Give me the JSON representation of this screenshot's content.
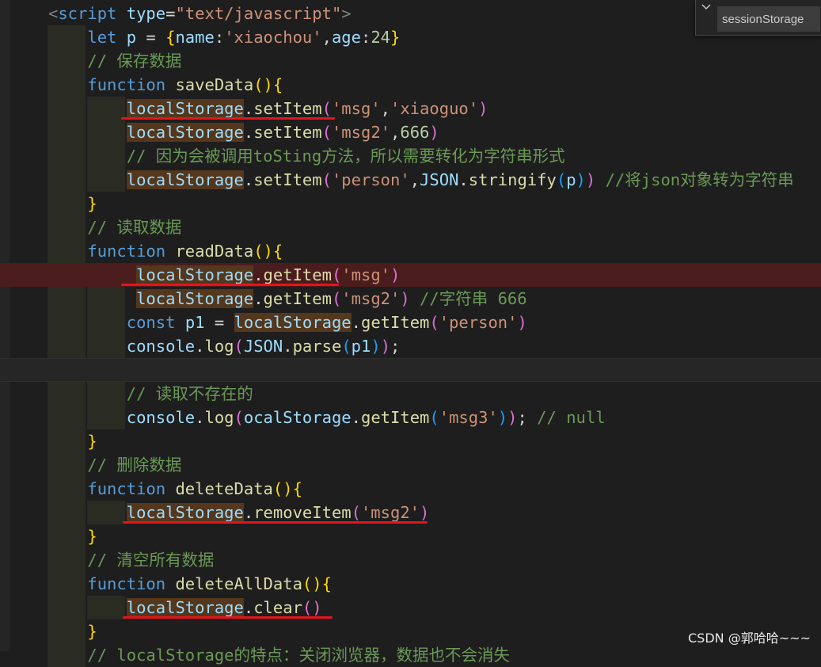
{
  "find_widget": {
    "value": "sessionStorage",
    "toggle_icon": "chevron-down-icon"
  },
  "watermark": "CSDN @郭哈哈~~~",
  "lines": [
    {
      "guides": [],
      "tokens": [
        {
          "t": "<",
          "c": "c-punc"
        },
        {
          "t": "script",
          "c": "c-tag"
        },
        {
          "t": " ",
          "c": "c-text"
        },
        {
          "t": "type",
          "c": "c-attr"
        },
        {
          "t": "=",
          "c": "c-text"
        },
        {
          "t": "\"text/javascript\"",
          "c": "c-str"
        },
        {
          "t": ">",
          "c": "c-punc"
        }
      ]
    },
    {
      "guides": [
        60
      ],
      "tokens": [
        {
          "t": "    ",
          "c": "c-text"
        },
        {
          "t": "let",
          "c": "c-kw"
        },
        {
          "t": " ",
          "c": "c-text"
        },
        {
          "t": "p",
          "c": "c-var"
        },
        {
          "t": " = ",
          "c": "c-text"
        },
        {
          "t": "{",
          "c": "c-b1"
        },
        {
          "t": "name",
          "c": "c-var"
        },
        {
          "t": ":",
          "c": "c-text"
        },
        {
          "t": "'xiaochou'",
          "c": "c-str"
        },
        {
          "t": ",",
          "c": "c-text"
        },
        {
          "t": "age",
          "c": "c-var"
        },
        {
          "t": ":",
          "c": "c-text"
        },
        {
          "t": "24",
          "c": "c-num"
        },
        {
          "t": "}",
          "c": "c-b1"
        }
      ]
    },
    {
      "guides": [
        60
      ],
      "tokens": [
        {
          "t": "    ",
          "c": "c-text"
        },
        {
          "t": "// 保存数据",
          "c": "c-com"
        }
      ]
    },
    {
      "guides": [
        60
      ],
      "tokens": [
        {
          "t": "    ",
          "c": "c-text"
        },
        {
          "t": "function",
          "c": "c-kw"
        },
        {
          "t": " ",
          "c": "c-text"
        },
        {
          "t": "saveData",
          "c": "c-fn"
        },
        {
          "t": "()",
          "c": "c-b1"
        },
        {
          "t": "{",
          "c": "c-b1"
        }
      ]
    },
    {
      "guides": [
        60,
        110
      ],
      "tokens": [
        {
          "t": "        ",
          "c": "c-text"
        },
        {
          "t": "localStorage",
          "c": "c-var",
          "hl": true
        },
        {
          "t": ".",
          "c": "c-text"
        },
        {
          "t": "setItem",
          "c": "c-fn"
        },
        {
          "t": "(",
          "c": "c-b2"
        },
        {
          "t": "'msg'",
          "c": "c-str"
        },
        {
          "t": ",",
          "c": "c-text"
        },
        {
          "t": "'xiaoguo'",
          "c": "c-str"
        },
        {
          "t": ")",
          "c": "c-b2"
        }
      ]
    },
    {
      "guides": [
        60,
        110
      ],
      "tokens": [
        {
          "t": "        ",
          "c": "c-text"
        },
        {
          "t": "localStorage",
          "c": "c-var",
          "hl": true
        },
        {
          "t": ".",
          "c": "c-text"
        },
        {
          "t": "setItem",
          "c": "c-fn"
        },
        {
          "t": "(",
          "c": "c-b2"
        },
        {
          "t": "'msg2'",
          "c": "c-str"
        },
        {
          "t": ",",
          "c": "c-text"
        },
        {
          "t": "666",
          "c": "c-num"
        },
        {
          "t": ")",
          "c": "c-b2"
        }
      ]
    },
    {
      "guides": [
        60,
        110
      ],
      "tokens": [
        {
          "t": "        ",
          "c": "c-text"
        },
        {
          "t": "// 因为会被调用toSting方法，所以需要转化为字符串形式",
          "c": "c-com"
        }
      ]
    },
    {
      "guides": [
        60,
        110
      ],
      "tokens": [
        {
          "t": "        ",
          "c": "c-text"
        },
        {
          "t": "localStorage",
          "c": "c-var",
          "hl": true
        },
        {
          "t": ".",
          "c": "c-text"
        },
        {
          "t": "setItem",
          "c": "c-fn"
        },
        {
          "t": "(",
          "c": "c-b2"
        },
        {
          "t": "'person'",
          "c": "c-str"
        },
        {
          "t": ",",
          "c": "c-text"
        },
        {
          "t": "JSON",
          "c": "c-var"
        },
        {
          "t": ".",
          "c": "c-text"
        },
        {
          "t": "stringify",
          "c": "c-fn"
        },
        {
          "t": "(",
          "c": "c-b3"
        },
        {
          "t": "p",
          "c": "c-var"
        },
        {
          "t": ")",
          "c": "c-b3"
        },
        {
          "t": ")",
          "c": "c-b2"
        },
        {
          "t": " ",
          "c": "c-text"
        },
        {
          "t": "//将json对象转为字符串",
          "c": "c-com"
        }
      ]
    },
    {
      "guides": [
        60
      ],
      "tokens": [
        {
          "t": "    ",
          "c": "c-text"
        },
        {
          "t": "}",
          "c": "c-b1"
        }
      ]
    },
    {
      "guides": [
        60
      ],
      "tokens": [
        {
          "t": "    ",
          "c": "c-text"
        },
        {
          "t": "// 读取数据",
          "c": "c-com"
        }
      ]
    },
    {
      "guides": [
        60
      ],
      "tokens": [
        {
          "t": "    ",
          "c": "c-text"
        },
        {
          "t": "function",
          "c": "c-kw"
        },
        {
          "t": " ",
          "c": "c-text"
        },
        {
          "t": "readData",
          "c": "c-fn"
        },
        {
          "t": "()",
          "c": "c-b1"
        },
        {
          "t": "{",
          "c": "c-b1"
        }
      ]
    },
    {
      "guides": [],
      "err": true,
      "tokens": [
        {
          "t": "         ",
          "c": "c-text"
        },
        {
          "t": "localStorage",
          "c": "c-var",
          "hl": true
        },
        {
          "t": ".",
          "c": "c-text"
        },
        {
          "t": "getItem",
          "c": "c-fn"
        },
        {
          "t": "(",
          "c": "c-b2"
        },
        {
          "t": "'msg'",
          "c": "c-str"
        },
        {
          "t": ")",
          "c": "c-b2"
        }
      ]
    },
    {
      "guides": [
        60,
        110
      ],
      "tokens": [
        {
          "t": "         ",
          "c": "c-text"
        },
        {
          "t": "localStorage",
          "c": "c-var",
          "hl": true
        },
        {
          "t": ".",
          "c": "c-text"
        },
        {
          "t": "getItem",
          "c": "c-fn"
        },
        {
          "t": "(",
          "c": "c-b2"
        },
        {
          "t": "'msg2'",
          "c": "c-str"
        },
        {
          "t": ")",
          "c": "c-b2"
        },
        {
          "t": " ",
          "c": "c-text"
        },
        {
          "t": "//字符串 666",
          "c": "c-com"
        }
      ]
    },
    {
      "guides": [
        60,
        110
      ],
      "tokens": [
        {
          "t": "        ",
          "c": "c-text"
        },
        {
          "t": "const",
          "c": "c-kw"
        },
        {
          "t": " ",
          "c": "c-text"
        },
        {
          "t": "p1",
          "c": "c-var"
        },
        {
          "t": " = ",
          "c": "c-text"
        },
        {
          "t": "localStorage",
          "c": "c-var",
          "hl": true
        },
        {
          "t": ".",
          "c": "c-text"
        },
        {
          "t": "getItem",
          "c": "c-fn"
        },
        {
          "t": "(",
          "c": "c-b2"
        },
        {
          "t": "'person'",
          "c": "c-str"
        },
        {
          "t": ")",
          "c": "c-b2"
        }
      ]
    },
    {
      "guides": [
        60,
        110
      ],
      "tokens": [
        {
          "t": "        ",
          "c": "c-text"
        },
        {
          "t": "console",
          "c": "c-var"
        },
        {
          "t": ".",
          "c": "c-text"
        },
        {
          "t": "log",
          "c": "c-fn"
        },
        {
          "t": "(",
          "c": "c-b2"
        },
        {
          "t": "JSON",
          "c": "c-var"
        },
        {
          "t": ".",
          "c": "c-text"
        },
        {
          "t": "parse",
          "c": "c-fn"
        },
        {
          "t": "(",
          "c": "c-b3"
        },
        {
          "t": "p1",
          "c": "c-var"
        },
        {
          "t": ")",
          "c": "c-b3"
        },
        {
          "t": ")",
          "c": "c-b2"
        },
        {
          "t": ";",
          "c": "c-text"
        }
      ]
    },
    {
      "guides": [],
      "cur": true,
      "tokens": []
    },
    {
      "guides": [
        60,
        110
      ],
      "tokens": [
        {
          "t": "        ",
          "c": "c-text"
        },
        {
          "t": "// 读取不存在的",
          "c": "c-com"
        }
      ]
    },
    {
      "guides": [
        60,
        110
      ],
      "tokens": [
        {
          "t": "        ",
          "c": "c-text"
        },
        {
          "t": "console",
          "c": "c-var"
        },
        {
          "t": ".",
          "c": "c-text"
        },
        {
          "t": "log",
          "c": "c-fn"
        },
        {
          "t": "(",
          "c": "c-b2"
        },
        {
          "t": "ocalStorage",
          "c": "c-var"
        },
        {
          "t": ".",
          "c": "c-text"
        },
        {
          "t": "getItem",
          "c": "c-fn"
        },
        {
          "t": "(",
          "c": "c-b3"
        },
        {
          "t": "'msg3'",
          "c": "c-str"
        },
        {
          "t": ")",
          "c": "c-b3"
        },
        {
          "t": ")",
          "c": "c-b2"
        },
        {
          "t": "; ",
          "c": "c-text"
        },
        {
          "t": "// null",
          "c": "c-com"
        }
      ]
    },
    {
      "guides": [
        60
      ],
      "tokens": [
        {
          "t": "    ",
          "c": "c-text"
        },
        {
          "t": "}",
          "c": "c-b1"
        }
      ]
    },
    {
      "guides": [
        60
      ],
      "tokens": [
        {
          "t": "    ",
          "c": "c-text"
        },
        {
          "t": "// 删除数据",
          "c": "c-com"
        }
      ]
    },
    {
      "guides": [
        60
      ],
      "tokens": [
        {
          "t": "    ",
          "c": "c-text"
        },
        {
          "t": "function",
          "c": "c-kw"
        },
        {
          "t": " ",
          "c": "c-text"
        },
        {
          "t": "deleteData",
          "c": "c-fn"
        },
        {
          "t": "()",
          "c": "c-b1"
        },
        {
          "t": "{",
          "c": "c-b1"
        }
      ]
    },
    {
      "guides": [
        60,
        110
      ],
      "tokens": [
        {
          "t": "        ",
          "c": "c-text"
        },
        {
          "t": "localStorage",
          "c": "c-var",
          "hl": true
        },
        {
          "t": ".",
          "c": "c-text"
        },
        {
          "t": "removeItem",
          "c": "c-fn"
        },
        {
          "t": "(",
          "c": "c-b2"
        },
        {
          "t": "'msg2'",
          "c": "c-str"
        },
        {
          "t": ")",
          "c": "c-b2"
        }
      ]
    },
    {
      "guides": [
        60
      ],
      "tokens": [
        {
          "t": "    ",
          "c": "c-text"
        },
        {
          "t": "}",
          "c": "c-b1"
        }
      ]
    },
    {
      "guides": [
        60
      ],
      "tokens": [
        {
          "t": "    ",
          "c": "c-text"
        },
        {
          "t": "// 清空所有数据",
          "c": "c-com"
        }
      ]
    },
    {
      "guides": [
        60
      ],
      "tokens": [
        {
          "t": "    ",
          "c": "c-text"
        },
        {
          "t": "function",
          "c": "c-kw"
        },
        {
          "t": " ",
          "c": "c-text"
        },
        {
          "t": "deleteAllData",
          "c": "c-fn"
        },
        {
          "t": "()",
          "c": "c-b1"
        },
        {
          "t": "{",
          "c": "c-b1"
        }
      ]
    },
    {
      "guides": [
        60,
        110
      ],
      "tokens": [
        {
          "t": "        ",
          "c": "c-text"
        },
        {
          "t": "localStorage",
          "c": "c-var",
          "hl": true
        },
        {
          "t": ".",
          "c": "c-text"
        },
        {
          "t": "clear",
          "c": "c-fn"
        },
        {
          "t": "()",
          "c": "c-b2"
        }
      ]
    },
    {
      "guides": [
        60
      ],
      "tokens": [
        {
          "t": "    ",
          "c": "c-text"
        },
        {
          "t": "}",
          "c": "c-b1"
        }
      ]
    },
    {
      "guides": [
        60
      ],
      "tokens": [
        {
          "t": "    ",
          "c": "c-text"
        },
        {
          "t": "// localStorage的特点：关闭浏览器，数据也不会消失",
          "c": "c-com"
        }
      ]
    }
  ]
}
